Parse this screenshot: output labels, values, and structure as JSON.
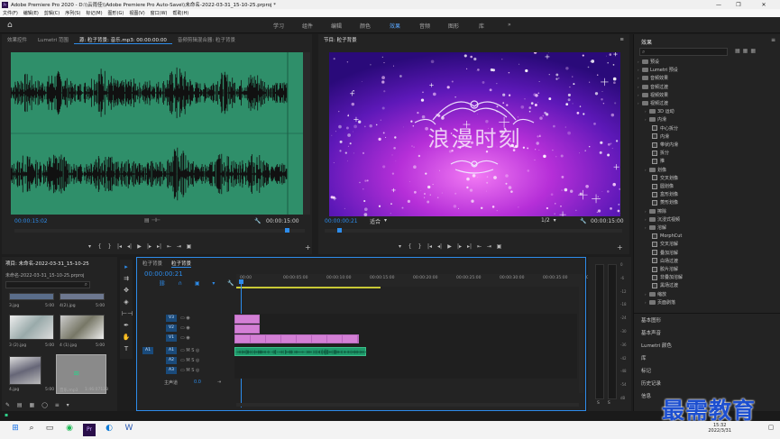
{
  "window": {
    "app_name": "Pr",
    "title": "Adobe Premiere Pro 2020 - D:\\\\云雨佳\\\\Adobe Premiere Pro Auto-Save\\\\未命名-2022-03-31_15-10-25.prproj *",
    "minimize": "—",
    "maximize": "❐",
    "close": "✕"
  },
  "menu": [
    "文件(F)",
    "编辑(E)",
    "剪辑(C)",
    "序列(S)",
    "标记(M)",
    "图形(G)",
    "视图(V)",
    "窗口(W)",
    "帮助(H)"
  ],
  "workspaces": {
    "items": [
      "学习",
      "组件",
      "编辑",
      "颜色",
      "效果",
      "音频",
      "图形",
      "库"
    ],
    "active": "效果",
    "more": "»"
  },
  "source_panel": {
    "tabs": [
      "效果控件",
      "Lumetri 范围",
      "源: 粒子背景: 音乐.mp3: 00:00:00:00",
      "音频剪辑混合器: 粒子背景"
    ],
    "active_tab": "源: 粒子背景: 音乐.mp3: 00:00:00:00",
    "channel_left": "L",
    "channel_right": "R",
    "timecode_current": "00:00:15:02",
    "timecode_duration": "00:00:15:00"
  },
  "program_panel": {
    "tab": "节目: 粒子背景",
    "video_title": "浪漫时刻",
    "timecode_current": "00:00:00:21",
    "fit": "适合",
    "resolution": "1/2",
    "timecode_duration": "00:00:15:00"
  },
  "transport": [
    "▾",
    "{",
    "}",
    "|◂",
    "◂|",
    "▶",
    "|▸",
    "▸|",
    "⇤",
    "⇥",
    "▣"
  ],
  "program_transport": [
    "▾",
    "{",
    "}",
    "|◂",
    "◂|",
    "▶",
    "|▸",
    "▸|",
    "⇤",
    "⇥",
    "▣"
  ],
  "project_panel": {
    "tab": "项目: 未命名-2022-03-31_15-10-25",
    "file": "未命名-2022-03-31_15-10-25.prproj",
    "items": [
      {
        "name": "3.jpg",
        "duration": "5:00"
      },
      {
        "name": "4(2).jpg",
        "duration": "5:00"
      },
      {
        "name": "3 (2).jpg",
        "duration": "5:00"
      },
      {
        "name": "4 (1).jpg",
        "duration": "5:00"
      },
      {
        "name": "4.jpg",
        "duration": "5:00"
      },
      {
        "name": "音乐.mp3",
        "duration": "1:46:07128"
      }
    ]
  },
  "timeline": {
    "tabs": [
      "粒子背景",
      "粒子背景"
    ],
    "active_tab": "粒子背景",
    "timecode": "00:00:00:21",
    "ruler": [
      "00:00",
      "00:00:05:00",
      "00:00:10:00",
      "00:00:15:00",
      "00:00:20:00",
      "00:00:25:00",
      "00:00:30:00",
      "00:00:35:00",
      "00:00:40:00"
    ],
    "video_tracks": [
      "V3",
      "V2",
      "V1"
    ],
    "audio_tracks": [
      "A1",
      "A2",
      "A3"
    ],
    "master": "主声道",
    "master_value": "0.0"
  },
  "meter": {
    "scale": [
      "0",
      "-6",
      "-12",
      "-18",
      "-24",
      "-30",
      "-36",
      "-42",
      "-48",
      "-54",
      "dB"
    ],
    "labels": [
      "S",
      "S"
    ]
  },
  "effects_panel": {
    "title": "效果",
    "menu_icon": "≡",
    "search_placeholder": "",
    "tree": [
      {
        "label": "预设",
        "level": 0,
        "type": "folder"
      },
      {
        "label": "Lumetri 预设",
        "level": 0,
        "type": "folder"
      },
      {
        "label": "音频效果",
        "level": 0,
        "type": "folder"
      },
      {
        "label": "音频过渡",
        "level": 0,
        "type": "folder"
      },
      {
        "label": "视频效果",
        "level": 0,
        "type": "folder"
      },
      {
        "label": "视频过渡",
        "level": 0,
        "type": "folder"
      },
      {
        "label": "3D 运动",
        "level": 1,
        "type": "folder"
      },
      {
        "label": "内滑",
        "level": 1,
        "type": "folder"
      },
      {
        "label": "中心拆分",
        "level": 2,
        "type": "fx"
      },
      {
        "label": "内滑",
        "level": 2,
        "type": "fx"
      },
      {
        "label": "带状内滑",
        "level": 2,
        "type": "fx"
      },
      {
        "label": "拆分",
        "level": 2,
        "type": "fx"
      },
      {
        "label": "推",
        "level": 2,
        "type": "fx"
      },
      {
        "label": "划像",
        "level": 1,
        "type": "folder"
      },
      {
        "label": "交叉划像",
        "level": 2,
        "type": "fx"
      },
      {
        "label": "圆划像",
        "level": 2,
        "type": "fx"
      },
      {
        "label": "盒形划像",
        "level": 2,
        "type": "fx"
      },
      {
        "label": "菱形划像",
        "level": 2,
        "type": "fx"
      },
      {
        "label": "擦除",
        "level": 1,
        "type": "folder"
      },
      {
        "label": "沉浸式视频",
        "level": 1,
        "type": "folder"
      },
      {
        "label": "溶解",
        "level": 1,
        "type": "folder"
      },
      {
        "label": "MorphCut",
        "level": 2,
        "type": "fx"
      },
      {
        "label": "交叉溶解",
        "level": 2,
        "type": "fx"
      },
      {
        "label": "叠加溶解",
        "level": 2,
        "type": "fx"
      },
      {
        "label": "白场过渡",
        "level": 2,
        "type": "fx"
      },
      {
        "label": "胶片溶解",
        "level": 2,
        "type": "fx"
      },
      {
        "label": "非叠加溶解",
        "level": 2,
        "type": "fx"
      },
      {
        "label": "黑场过渡",
        "level": 2,
        "type": "fx"
      },
      {
        "label": "缩放",
        "level": 1,
        "type": "folder"
      },
      {
        "label": "页面剥落",
        "level": 1,
        "type": "folder"
      }
    ],
    "sections": [
      "基本图形",
      "基本声音",
      "Lumetri 颜色",
      "库",
      "标记",
      "历史记录",
      "信息"
    ]
  },
  "taskbar": {
    "time": "15:32",
    "date": "2022/3/31"
  },
  "watermark": "最需教育",
  "colors": {
    "accent": "#2d8ceb",
    "waveform_bg": "#2f8f6a",
    "clip_pink": "#d37fd5",
    "audio_clip": "#1f9a6b"
  }
}
